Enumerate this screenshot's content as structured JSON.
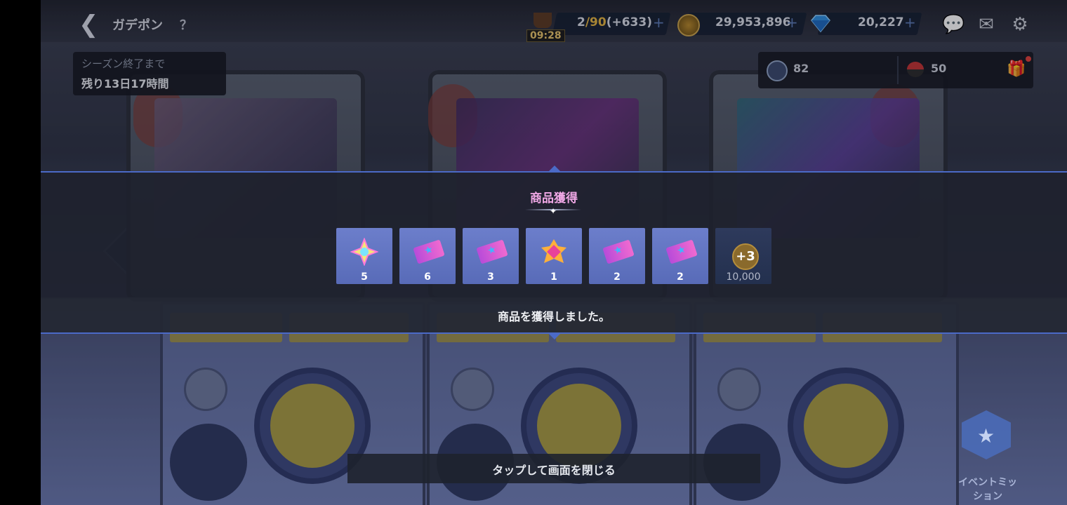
{
  "header": {
    "back_icon": "chevron-left-icon",
    "title": "ガデポン",
    "help": "？",
    "stamina": {
      "current": "2",
      "sep_max": "/90",
      "bonus": "(+633)",
      "timer": "09:28"
    },
    "gold": "29,953,896",
    "gems": "20,227",
    "plus": "+",
    "icons": [
      "chat-icon",
      "mail-icon",
      "gear-icon"
    ]
  },
  "season": {
    "label": "シーズン終了まで",
    "remaining": "残り13日17時間"
  },
  "tokens": {
    "token_a": "82",
    "token_b": "50"
  },
  "reward_panel": {
    "title": "商品獲得",
    "items": [
      {
        "icon": "rainbow-gem-icon",
        "qty": "5"
      },
      {
        "icon": "ticket-icon",
        "qty": "6"
      },
      {
        "icon": "ticket-icon",
        "qty": "3"
      },
      {
        "icon": "sun-crystal-icon",
        "qty": "1"
      },
      {
        "icon": "ticket-icon",
        "qty": "2"
      },
      {
        "icon": "ticket-icon",
        "qty": "2"
      },
      {
        "icon": "more-rewards-icon",
        "badge": "+3",
        "qty": "10,000"
      }
    ],
    "message": "商品を獲得しました。"
  },
  "close_hint": "タップして画面を閉じる",
  "event_mission": {
    "label_line1": "イベントミッ",
    "label_line2": "ション"
  },
  "colors": {
    "panel_border": "#4b6ac7",
    "title_pink": "#f0a8e6",
    "item_tile": "#6c7ecb"
  }
}
